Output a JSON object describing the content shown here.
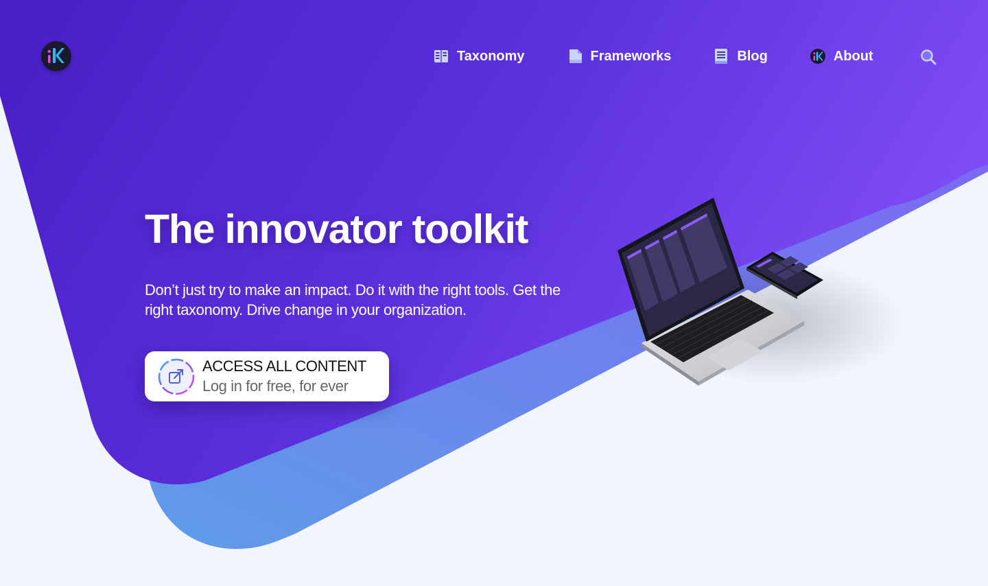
{
  "brand": {
    "logo_icon": "ik-logo-icon"
  },
  "nav": {
    "items": [
      {
        "label": "Taxonomy",
        "icon": "taxonomy-icon"
      },
      {
        "label": "Frameworks",
        "icon": "frameworks-icon"
      },
      {
        "label": "Blog",
        "icon": "blog-icon"
      },
      {
        "label": "About",
        "icon": "about-logo-icon"
      }
    ],
    "search_icon": "search-icon"
  },
  "hero": {
    "title": "The innovator toolkit",
    "subtitle": "Don’t just try to make an impact. Do it with the right tools. Get the right taxonomy. Drive change in your organization.",
    "cta": {
      "title": "ACCESS ALL CONTENT",
      "subtitle": "Log in for free, for ever",
      "icon": "external-link-icon"
    },
    "image": "laptop-and-phone-illustration"
  },
  "colors": {
    "hero_gradient_start": "#4a1fc8",
    "hero_gradient_end": "#7e4cf5",
    "band_start": "#5f9ae8",
    "band_end": "#7a66f0",
    "page_background": "#f1f5fe",
    "accent_pink": "#e04fd6",
    "accent_cyan": "#35b8f0"
  }
}
